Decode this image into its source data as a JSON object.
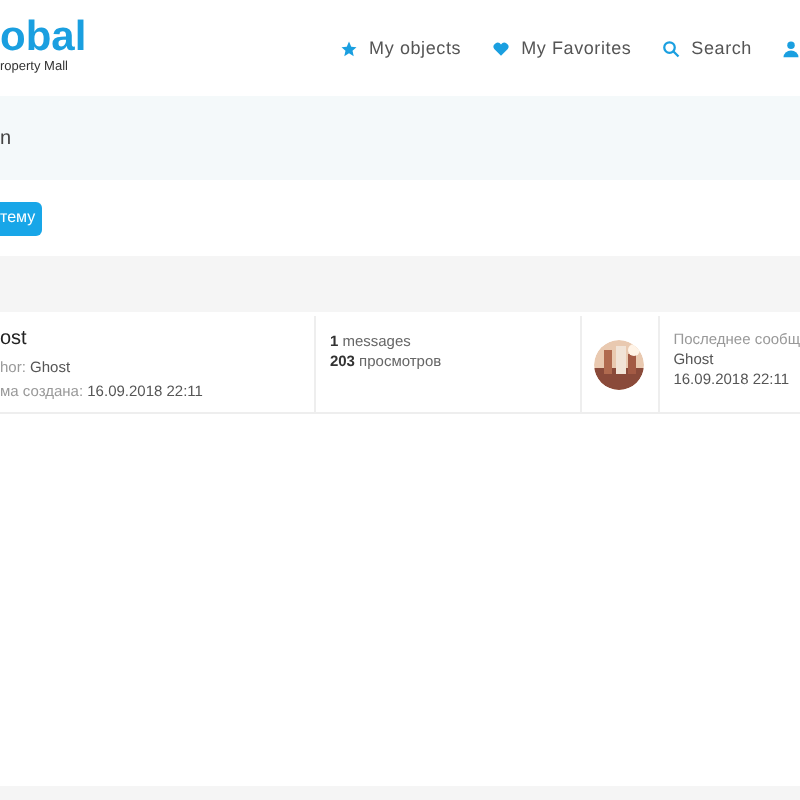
{
  "logo": {
    "name": "obal",
    "tagline": "roperty Mall"
  },
  "nav": [
    {
      "kind": "star",
      "label": "My objects"
    },
    {
      "kind": "heart",
      "label": "My Favorites"
    },
    {
      "kind": "search",
      "label": "Search"
    },
    {
      "kind": "user"
    }
  ],
  "banner": {
    "text": "n"
  },
  "new_topic_button": "тему",
  "topics": [
    {
      "title": "ost",
      "author_label": "hor:",
      "author": "Ghost",
      "created_label": "ма создана:",
      "created": "16.09.2018 22:11",
      "messages_count": "1",
      "messages_label": "messages",
      "views_count": "203",
      "views_label": "просмотров",
      "last_label": "Последнее сообщ",
      "last_author": "Ghost",
      "last_date": "16.09.2018 22:11"
    }
  ]
}
